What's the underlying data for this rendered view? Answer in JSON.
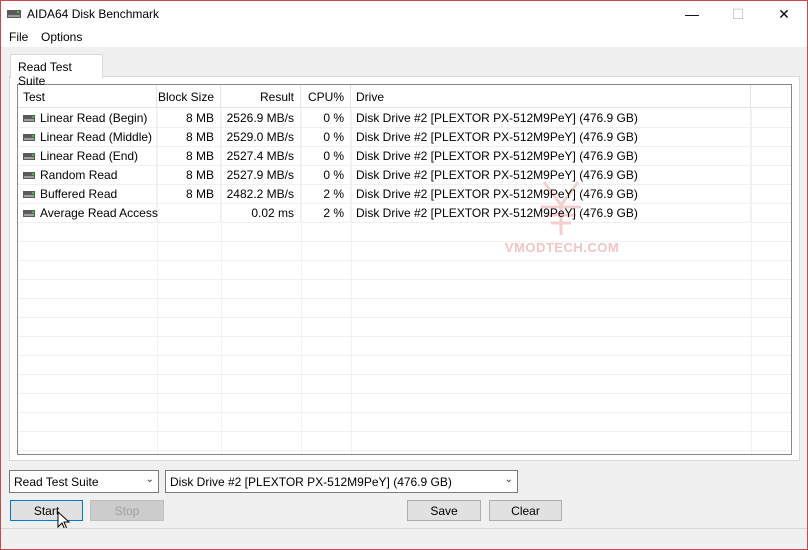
{
  "window": {
    "title": "AIDA64 Disk Benchmark",
    "controls": {
      "minimize": "—",
      "maximize": "☐",
      "close": "✕"
    }
  },
  "menu": {
    "file": "File",
    "options": "Options"
  },
  "tab": {
    "label": "Read Test Suite"
  },
  "table": {
    "columns": [
      "Test",
      "Block Size",
      "Result",
      "CPU%",
      "Drive"
    ],
    "rows": [
      {
        "test": "Linear Read (Begin)",
        "block": "8 MB",
        "result": "2526.9 MB/s",
        "cpu": "0 %",
        "drive": "Disk Drive #2  [PLEXTOR PX-512M9PeY]  (476.9 GB)"
      },
      {
        "test": "Linear Read (Middle)",
        "block": "8 MB",
        "result": "2529.0 MB/s",
        "cpu": "0 %",
        "drive": "Disk Drive #2  [PLEXTOR PX-512M9PeY]  (476.9 GB)"
      },
      {
        "test": "Linear Read (End)",
        "block": "8 MB",
        "result": "2527.4 MB/s",
        "cpu": "0 %",
        "drive": "Disk Drive #2  [PLEXTOR PX-512M9PeY]  (476.9 GB)"
      },
      {
        "test": "Random Read",
        "block": "8 MB",
        "result": "2527.9 MB/s",
        "cpu": "0 %",
        "drive": "Disk Drive #2  [PLEXTOR PX-512M9PeY]  (476.9 GB)"
      },
      {
        "test": "Buffered Read",
        "block": "8 MB",
        "result": "2482.2 MB/s",
        "cpu": "2 %",
        "drive": "Disk Drive #2  [PLEXTOR PX-512M9PeY]  (476.9 GB)"
      },
      {
        "test": "Average Read Access",
        "block": "",
        "result": "0.02 ms",
        "cpu": "2 %",
        "drive": "Disk Drive #2  [PLEXTOR PX-512M9PeY]  (476.9 GB)"
      }
    ]
  },
  "watermark": "VMODTECH.COM",
  "controls": {
    "suite_select": "Read Test Suite",
    "drive_select": "Disk Drive #2  [PLEXTOR PX-512M9PeY]  (476.9 GB)",
    "start": "Start",
    "stop": "Stop",
    "save": "Save",
    "clear": "Clear"
  },
  "colors": {
    "window_border": "#c84a4a",
    "start_focus": "#0078d7",
    "watermark": "#f2c4c4"
  }
}
